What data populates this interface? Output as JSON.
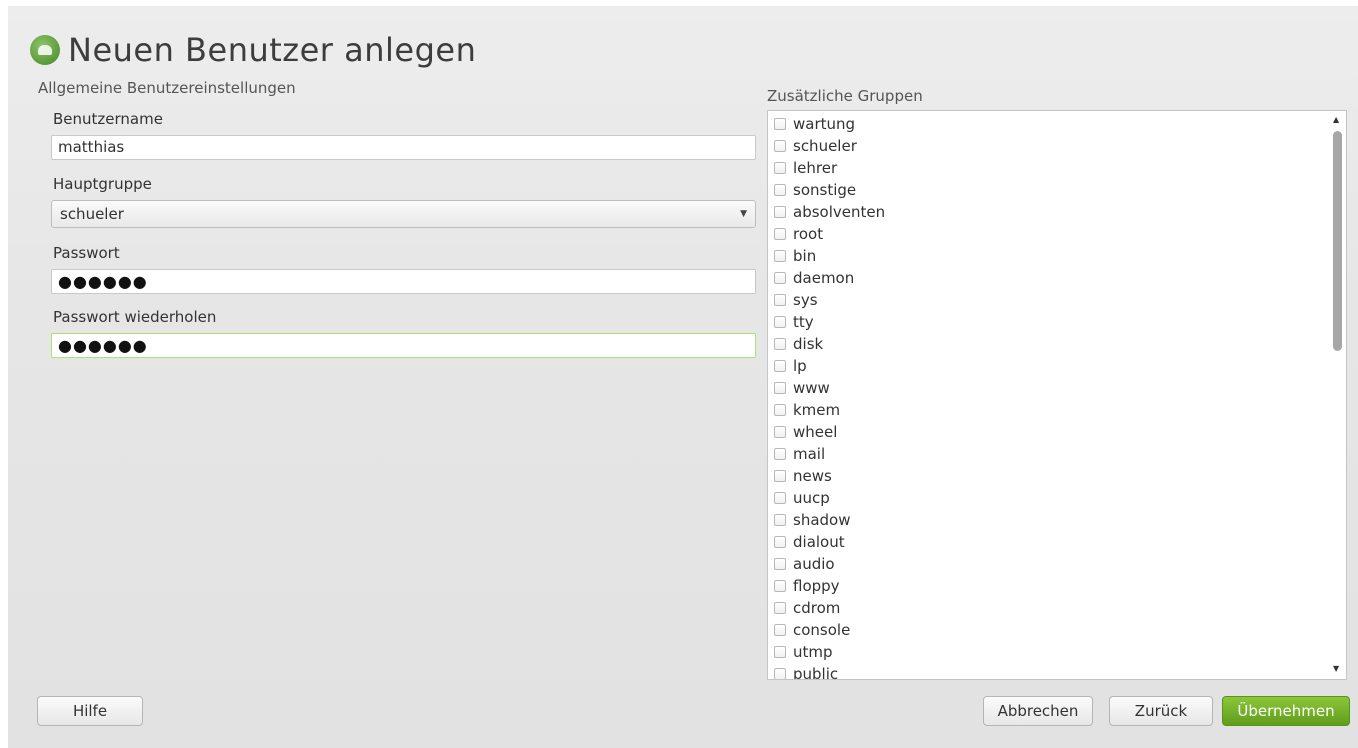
{
  "dialog": {
    "title": "Neuen Benutzer anlegen",
    "left_section": "Allgemeine Benutzereinstellungen",
    "right_section": "Zusätzliche Gruppen",
    "accent_color": "#6aa82e"
  },
  "form": {
    "username_label": "Benutzername",
    "username_value": "matthias",
    "group_label": "Hauptgruppe",
    "group_value": "schueler",
    "password_label": "Passwort",
    "password_value": "●●●●●●",
    "password_repeat_label": "Passwort wiederholen",
    "password_repeat_value": "●●●●●●"
  },
  "groups": [
    "wartung",
    "schueler",
    "lehrer",
    "sonstige",
    "absolventen",
    "root",
    "bin",
    "daemon",
    "sys",
    "tty",
    "disk",
    "lp",
    "www",
    "kmem",
    "wheel",
    "mail",
    "news",
    "uucp",
    "shadow",
    "dialout",
    "audio",
    "floppy",
    "cdrom",
    "console",
    "utmp",
    "public"
  ],
  "buttons": {
    "help": "Hilfe",
    "cancel": "Abbrechen",
    "back": "Zurück",
    "apply": "Übernehmen"
  }
}
